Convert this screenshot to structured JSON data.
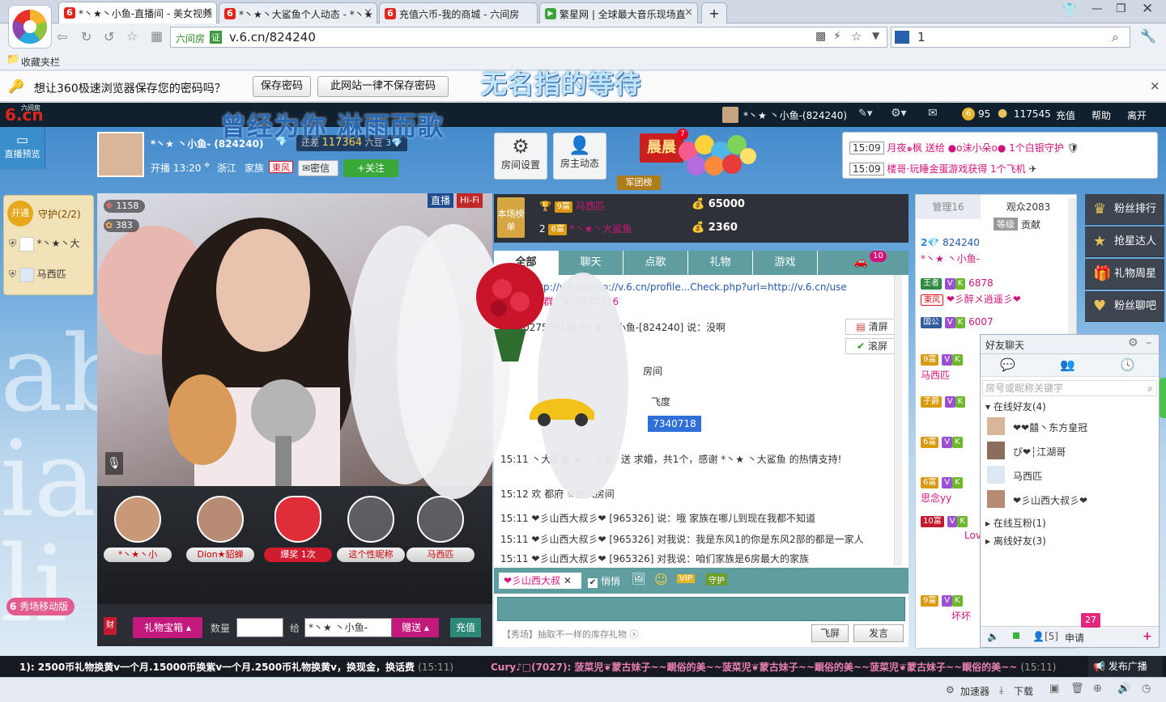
{
  "browser": {
    "tabs": [
      {
        "label": "*丶★丶小鱼-直播间 - 美女视频",
        "icon": "6",
        "active": true
      },
      {
        "label": "*丶★丶大鲨鱼个人动态 - *丶★",
        "icon": "6",
        "active": false
      },
      {
        "label": "充值六币-我的商城 - 六间房",
        "icon": "6",
        "active": false
      },
      {
        "label": "繁星网 | 全球最大音乐现场直",
        "icon": "▶",
        "active": false
      }
    ],
    "new_tab": "+",
    "address_label": "六间房",
    "address_badge": "证",
    "url": "v.6.cn/824240",
    "search_value": "1",
    "bookmarks_label": "收藏夹栏",
    "password_prompt": "想让360极速浏览器保存您的密码吗？",
    "save_password": "保存密码",
    "never_save": "此网站一律不保存密码",
    "close_x": "×",
    "status_accel": "加速器",
    "status_download": "下载"
  },
  "overlay_lyrics": {
    "line1": "无名指的等待",
    "line2": "曾经为你 淋雨而歌"
  },
  "site": {
    "logo": "6.cn",
    "logo_small": "六间房",
    "user_status": "*丶★ 丶小鱼-(824240)",
    "coins": "95",
    "beans": "117545",
    "recharge": "充值",
    "help": "帮助",
    "leave": "离开",
    "live_preview": "直播预览",
    "anchor": {
      "name": "*丶★ 丶小鱼- (824240)",
      "remaining_label": "还差",
      "remaining_value": "117364",
      "remaining_unit": "六豆",
      "level": "3",
      "start_label": "开播 13:20",
      "location": "浙江",
      "family_label": "家族",
      "family": "東风",
      "message": "密信",
      "follow": "+关注"
    },
    "room_settings": "房间设置",
    "host_updates": "房主动态",
    "morning": "晨晨",
    "morning_count": "7",
    "army": "军团榜",
    "notices": [
      {
        "time": "15:09",
        "text": "月夜๑枫 送给 ●o沫小朵o● 1个白银守护"
      },
      {
        "time": "15:09",
        "text": "楼哥·玩睡金蛋游戏获得 1个飞机"
      }
    ],
    "guard": {
      "open": "开通",
      "label": "守护(2/2)",
      "members": [
        "*丶★丶大",
        "马西匹"
      ]
    },
    "video": {
      "live": "直播",
      "hifi": "Hi-Fi",
      "wealth": "1158",
      "charm": "383"
    },
    "gift_cards": [
      {
        "label": "*丶★丶小"
      },
      {
        "label": "Dion★貂蝉"
      },
      {
        "label": "爆奖",
        "sub": "1次"
      },
      {
        "label": "这个性昵称"
      },
      {
        "label": "马西匹"
      }
    ],
    "gift_bar": {
      "chest": "礼物宝箱",
      "qty_label": "数量",
      "to_label": "给",
      "to_value": "*丶★ 丶小鱼-",
      "send": "赠送",
      "recharge": "充值"
    },
    "mobile_show": "秀场移动版",
    "rank": {
      "title": "本场榜单",
      "rows": [
        {
          "rank": "1",
          "name": "马西匹",
          "value": "65000",
          "level": "9富"
        },
        {
          "rank": "2",
          "name": "*丶★丶大鲨鱼",
          "value": "2360",
          "level": "6富"
        }
      ]
    },
    "chat_tabs": [
      "全部",
      "聊天",
      "点歌",
      "礼物",
      "游戏"
    ],
    "car_count": "10",
    "clear": "清屏",
    "scroll": "滚屏",
    "chat_messages": [
      {
        "text": "充值：http://v.6.cnhttp://v.6.cn/profile...Check.php?url=http://v.6.cn/use"
      },
      {
        "text": "...16820 群：429330816"
      },
      {
        "text": "币 [6027555] 对 *丶★ 丶小鱼-[824240] 说：没啊"
      },
      {
        "text": "房间"
      },
      {
        "text": "飞度"
      },
      {
        "text": "7340718"
      },
      {
        "text": "15:11 丶大鲨鱼 ★ 丶小鱼- 送 求婚，共1个，感谢 *丶★ 丶大鲨鱼 的热情支持!"
      },
      {
        "text": "15:12 欢 都府 ☆进入房间"
      },
      {
        "text": "15:11 ❤彡山西大叔彡❤ [965326] 说：哦 家族在哪儿到现在我都不知道"
      },
      {
        "text": "15:11 ❤彡山西大叔彡❤ [965326] 对我说：我是东风1的你是东风2部的都是一家人"
      },
      {
        "text": "15:11 ❤彡山西大叔彡❤ [965326] 对我说：咱们家族是6房最大的家族"
      }
    ],
    "chat_to": "❤彡山西大叔",
    "whisper": "悄悄",
    "chat_footer": "【秀场】抽取不一样的库存礼物",
    "fly_screen": "飞屏",
    "send_msg": "发言",
    "admin_label": "管理16",
    "audience_label": "观众2083",
    "level_label": "等级",
    "contrib_label": "贡献",
    "audience": [
      {
        "name": "824240"
      },
      {
        "name": "*丶★ 丶小鱼-"
      },
      {
        "name": "6878"
      },
      {
        "name": "❤彡醉メ逍遥彡❤"
      },
      {
        "name": "6007"
      },
      {
        "name": "马西匹"
      },
      {
        "name": "思念yy"
      },
      {
        "name": "Love"
      },
      {
        "name": "坏坏"
      }
    ],
    "side_buttons": [
      "粉丝排行",
      "抢星达人",
      "礼物周星",
      "粉丝聊吧"
    ],
    "friends": {
      "title": "好友聊天",
      "search_placeholder": "房号或昵称关键字",
      "online_group": "在线好友(4)",
      "members": [
        "❤❤囍丶东方皇冠",
        "ぴ❤┆江湖哥",
        "马西匹",
        "❤彡山西大叔彡❤"
      ],
      "mutual_group": "在线互粉(1)",
      "offline_group": "离线好友(3)",
      "apply": "申请",
      "apply_count": "27",
      "footer_count": "[5]"
    },
    "ticker": {
      "left": "1): 2500币礼物换黄v一个月.15000币换紫v一个月.2500币礼物换黄v，换现金，换话费",
      "left_time": "(15:11)",
      "right": "Cury♪□(7027): 菠菜児❦蒙古妹子~~靦俗的美~~菠菜児❦蒙古妹子~~靦俗的美~~菠菜児❦蒙古妹子~~靦俗的美~~",
      "right_time": "(15:11)",
      "publish": "发布广播"
    }
  },
  "colors": {
    "accent_pink": "#d1147b",
    "brand_red": "#e1251b",
    "dark_bar": "#10202f",
    "teal": "#5a9e9e"
  }
}
